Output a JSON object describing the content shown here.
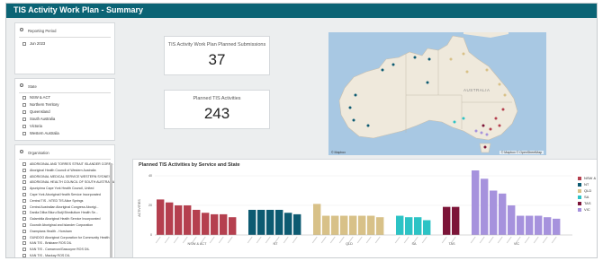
{
  "window": {
    "title": "TIS Activity Work Plan - Summary"
  },
  "filters": {
    "reporting_period": {
      "title": "Reporting Period",
      "items": [
        "Jun 2023"
      ]
    },
    "state": {
      "title": "State",
      "items": [
        "NSW & ACT",
        "Northern Territory",
        "Queensland",
        "South Australia",
        "Victoria",
        "Western Australia"
      ]
    },
    "organisation": {
      "title": "Organisation",
      "items": [
        "ABORIGINAL AND TORRES STRAIT ISLANDER CORP...",
        "Aboriginal Health Council of Western Australia",
        "ABORIGINAL MEDICAL SERVICE WESTERN SYDNEY",
        "ABORIGINAL HEALTH COUNCIL OF SOUTH AUSTRALIA",
        "Apunipima Cape York Health Council, United",
        "Cape York Aboriginal Health Service Incorporated",
        "Central TIS - NTED TIS Alice Springs",
        "Central Australian Aboriginal Congress Aborigi...",
        "Danila Dilba Biluru Butji Binnilutlum Health Se...",
        "Galambila Aboriginal Health Service Incorporated",
        "Goondir Aboriginal and Islander Corporation",
        "Grampians Health - Horsham",
        "GUNDOO Aboriginal Corporation for Community Health",
        "KAN TIS - Brisbane ROS DIL",
        "KAN TIS - Carnarvon/Gascoyne ROS DIL",
        "KAN TIS - Mackay ROS DIL"
      ]
    }
  },
  "kpis": {
    "submissions": {
      "label": "TIS Activity Work Plan Planned Submissions",
      "value": "37"
    },
    "activities": {
      "label": "Planned TIS Activities",
      "value": "243"
    }
  },
  "map": {
    "label": "AUSTRALIA",
    "logo": "© Mapbox",
    "credit": "© Mapbox © OpenStreetMap"
  },
  "chart_data": {
    "type": "bar",
    "title": "Planned TIS Activities by Service and State",
    "ylabel": "ACTIVITIES",
    "ylim": [
      0,
      40
    ],
    "yticks": [
      0,
      20,
      40
    ],
    "groups": [
      {
        "state": "NSW & ACT",
        "color": "#b5404f",
        "values": [
          24,
          22,
          20,
          20,
          17,
          15,
          14,
          14,
          12
        ]
      },
      {
        "state": "NT",
        "color": "#0d5b72",
        "values": [
          17,
          17,
          17,
          17,
          15,
          14
        ]
      },
      {
        "state": "QLD",
        "color": "#d8c188",
        "values": [
          21,
          13,
          13,
          13,
          13,
          13,
          13,
          12
        ]
      },
      {
        "state": "SA",
        "color": "#2cc3c5",
        "values": [
          13,
          12,
          12,
          10
        ]
      },
      {
        "state": "TAS",
        "color": "#7c1438",
        "values": [
          19,
          19
        ]
      },
      {
        "state": "VIC",
        "color": "#a692dd",
        "values": [
          44,
          38,
          30,
          28,
          20,
          13,
          13,
          13,
          12,
          11
        ]
      }
    ],
    "legend": [
      "NSW & ACT",
      "NT",
      "QLD",
      "SA",
      "TAS",
      "VIC"
    ],
    "legend_colors": [
      "#b5404f",
      "#0d5b72",
      "#d8c188",
      "#2cc3c5",
      "#7c1438",
      "#a692dd"
    ]
  }
}
